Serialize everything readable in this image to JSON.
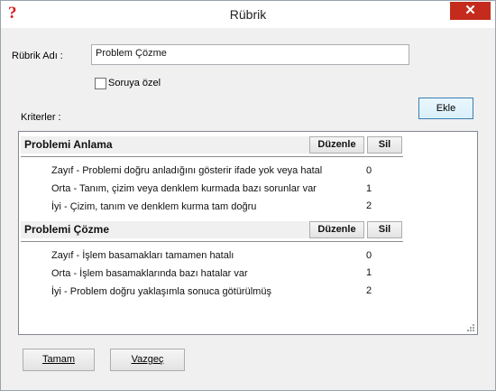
{
  "window": {
    "title": "Rübrik",
    "help_icon": "?",
    "close_icon": "✕"
  },
  "form": {
    "name_label": "Rübrik Adı :",
    "name_value": "Problem Çözme",
    "checkbox_label": "Soruya özel",
    "criteria_label": "Kriterler :",
    "add_button": "Ekle"
  },
  "sections": [
    {
      "title": "Problemi Anlama",
      "edit_label": "Düzenle",
      "delete_label": "Sil",
      "criteria": [
        {
          "text": "Zayıf - Problemi doğru anladığını gösterir ifade yok veya hatal",
          "score": "0"
        },
        {
          "text": "Orta - Tanım, çizim veya denklem kurmada bazı sorunlar var",
          "score": "1"
        },
        {
          "text": "İyi - Çizim, tanım ve denklem kurma tam doğru",
          "score": "2"
        }
      ]
    },
    {
      "title": "Problemi Çözme",
      "edit_label": "Düzenle",
      "delete_label": "Sil",
      "criteria": [
        {
          "text": "Zayıf - İşlem basamakları tamamen hatalı",
          "score": "0"
        },
        {
          "text": "Orta - İşlem basamaklarında bazı hatalar var",
          "score": "1"
        },
        {
          "text": "İyi - Problem doğru yaklaşımla sonuca götürülmüş",
          "score": "2"
        }
      ]
    }
  ],
  "footer": {
    "ok_label": "Tamam",
    "cancel_label": "Vazgeç"
  },
  "colors": {
    "close": "#c42b1c",
    "help": "#d81e1e",
    "primary_border": "#3c7fb1"
  }
}
